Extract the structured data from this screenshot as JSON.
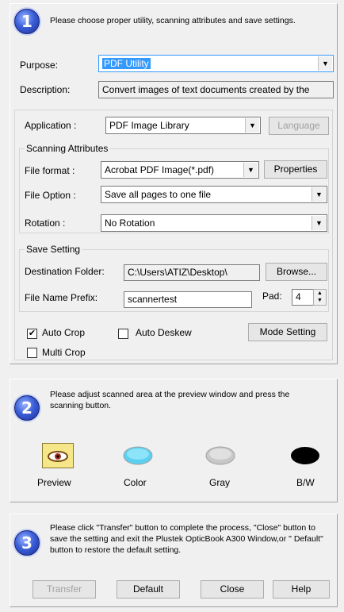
{
  "step1": {
    "number": "1",
    "instruction": "Please choose proper utility, scanning attributes and save settings.",
    "purpose_label": "Purpose:",
    "purpose_value": "PDF Utility",
    "description_label": "Description:",
    "description_value": "Convert images of text documents created by the",
    "application_label": "Application :",
    "application_value": "PDF Image Library",
    "language_button": "Language",
    "scanning_attributes_title": "Scanning Attributes",
    "file_format_label": "File format :",
    "file_format_value": "Acrobat PDF Image(*.pdf)",
    "properties_button": "Properties",
    "file_option_label": "File Option :",
    "file_option_value": "Save all pages to one file",
    "rotation_label": "Rotation :",
    "rotation_value": "No Rotation",
    "save_setting_title": "Save Setting",
    "destination_label": "Destination Folder:",
    "destination_value": "C:\\Users\\ATIZ\\Desktop\\",
    "browse_button": "Browse...",
    "prefix_label": "File Name Prefix:",
    "prefix_value": "scannertest",
    "pad_label": "Pad:",
    "pad_value": "4",
    "auto_crop_label": "Auto Crop",
    "auto_crop_checked": true,
    "auto_deskew_label": "Auto Deskew",
    "multi_crop_label": "Multi Crop",
    "mode_setting_button": "Mode Setting"
  },
  "step2": {
    "number": "2",
    "instruction": "Please adjust scanned area at the preview window and press the scanning button.",
    "buttons": [
      "Preview",
      "Color",
      "Gray",
      "B/W"
    ]
  },
  "step3": {
    "number": "3",
    "instruction": "Please click \"Transfer\" button to complete the process, \"Close\" button to save the setting and exit the Plustek OpticBook A300 Window,or \" Default\" button to restore the default setting.",
    "transfer_button": "Transfer",
    "default_button": "Default",
    "close_button": "Close",
    "help_button": "Help"
  },
  "colors": {
    "selection": "#3399ff",
    "badge": "#3b5fd8",
    "color_scan": "#5bd0f0",
    "gray_scan": "#c8c8c8",
    "bw_scan": "#000000",
    "preview_bg": "#f5e68a"
  }
}
